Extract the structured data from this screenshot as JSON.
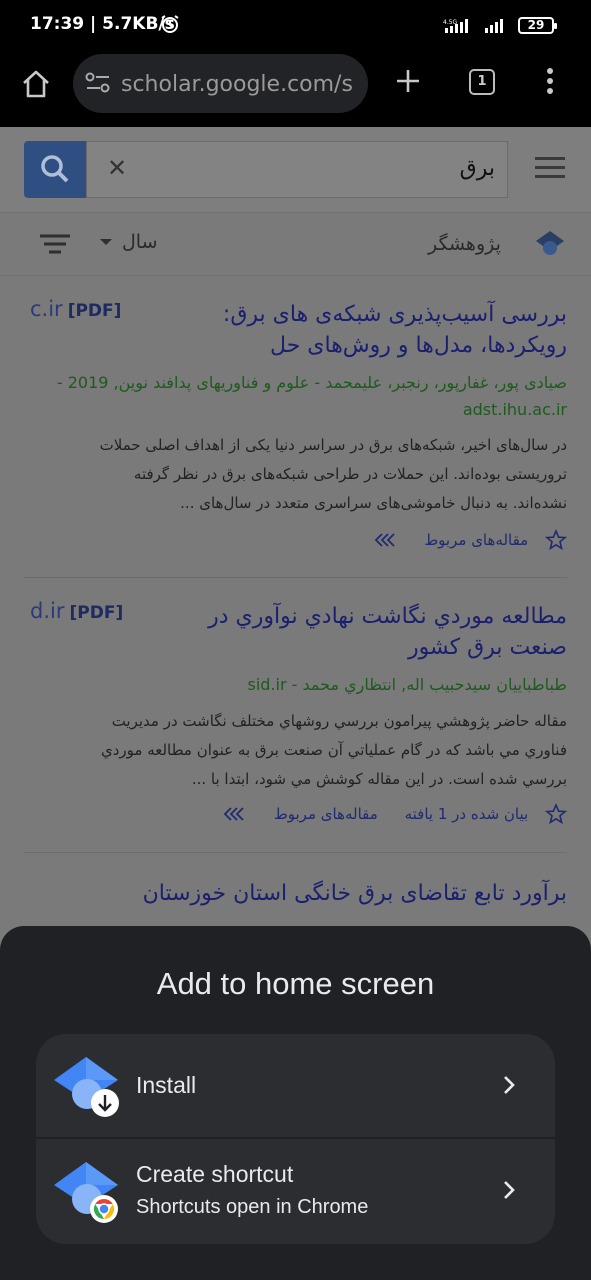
{
  "status_bar": {
    "time": "17:39",
    "speed": "5.7KB/s",
    "network_label": "4.5G",
    "battery": "29"
  },
  "browser": {
    "url": "scholar.google.com/s",
    "tab_count": "1"
  },
  "search": {
    "query": "برق",
    "clear_glyph": "✕"
  },
  "filters": {
    "year_label": "سال",
    "researcher_label": "پژوهشگر"
  },
  "results": [
    {
      "pdf_domain": "c.ir",
      "pdf_tag": "[PDF]",
      "title_line1": "بررسی آسیب‌پذیری شبکه‌ی های برق:",
      "title_line2": "رویکردها، مدل‌ها و روش‌های حل",
      "meta_line1": "صیادی پور، غفارپور، رنجبر، علیمحمد - علوم و فناوریهای پدافند نوین, 2019 -",
      "meta_line2": "adst.ihu.ac.ir",
      "snippet_line1": "در سال‌های اخیر، شبکه‌های برق در سراسر دنیا یکی از اهداف اصلی حملات",
      "snippet_line2": "تروریستی بوده‌اند. این حملات در طراحی شبکه‌های برق در نظر گرفته",
      "snippet_line3": "نشده‌اند. به دنبال خاموشی‌های سراسری متعدد در سال‌های ...",
      "related": "مقاله‌های مربوط"
    },
    {
      "pdf_domain": "d.ir",
      "pdf_tag": "[PDF]",
      "title_line1": "مطالعه موردي نگاشت نهادي نوآوري در",
      "title_line2": "صنعت برق کشور",
      "meta_line1": "طباطباييان سيدحبيب اله, انتظاري محمد - sid.ir",
      "snippet_line1": "مقاله حاضر پژوهشي پيرامون بررسي روشهاي مختلف نگاشت در مديريت",
      "snippet_line2": "فناوري مي باشد که در گام عملياتي آن صنعت برق به عنوان مطالعه موردي",
      "snippet_line3": "بررسي شده است. در اين مقاله کوشش مي شود، ابتدا با ...",
      "cited": "بیان شده در 1 یافته",
      "related": "مقاله‌های مربوط"
    },
    {
      "title_line1": "برآورد تابع تقاضای برق خانگی استان خوزستان"
    }
  ],
  "sheet": {
    "title": "Add to home screen",
    "install_label": "Install",
    "shortcut_label": "Create shortcut",
    "shortcut_sub": "Shortcuts open in Chrome"
  },
  "colors": {
    "sheet_bg": "#202124",
    "card_bg": "#2c2d30",
    "scholar_blue": "#4285f4",
    "link_color": "#1a1f6e",
    "meta_green": "#1e5a1e"
  },
  "icons": [
    "alarm-icon",
    "signal-icon",
    "battery-icon",
    "home-icon",
    "site-settings-icon",
    "new-tab-icon",
    "tab-switcher-icon",
    "more-vert-icon",
    "search-icon",
    "clear-icon",
    "menu-icon",
    "filter-icon",
    "scholar-cap-icon",
    "star-icon",
    "related-arrows-icon",
    "install-app-icon",
    "chrome-shortcut-icon",
    "chevron-right-icon"
  ]
}
